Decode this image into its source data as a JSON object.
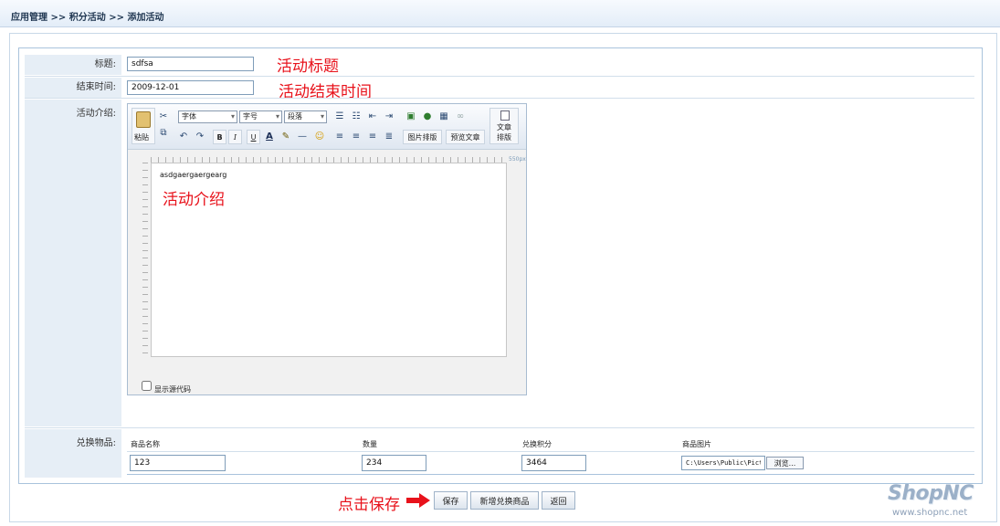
{
  "breadcrumb": "应用管理 >> 积分活动 >> 添加活动",
  "form": {
    "title_label": "标题:",
    "title_value": "sdfsa",
    "end_label": "结束时间:",
    "end_value": "2009-12-01",
    "intro_label": "活动介绍:",
    "items_label": "兑换物品:"
  },
  "annotations": {
    "title": "活动标题",
    "end": "活动结束时间",
    "intro": "活动介绍",
    "save": "点击保存"
  },
  "editor": {
    "paste": "粘贴",
    "font_select": "字体",
    "size_select": "字号",
    "para_select": "段落",
    "image_layout": "图片排版",
    "preview": "预览文章",
    "article_layout_1": "文章",
    "article_layout_2": "排版",
    "bold": "B",
    "italic": "I",
    "underline": "U",
    "ruler_mark": "550px",
    "content": "asdgaergaergearg",
    "show_source": "显示源代码"
  },
  "items": {
    "headers": [
      "商品名称",
      "数量",
      "兑换积分",
      "商品图片"
    ],
    "name_value": "123",
    "qty_value": "234",
    "points_value": "3464",
    "image_value": "C:\\Users\\Public\\Pictu",
    "browse": "浏览..."
  },
  "buttons": {
    "save": "保存",
    "add_item": "新增兑换商品",
    "back": "返回"
  },
  "logo": {
    "brand": "ShopNC",
    "url": "www.shopnc.net"
  },
  "colors": {
    "accent_red": "#e8121b",
    "label_bg": "#e6eef6",
    "border_blue": "#a9c3dc"
  }
}
